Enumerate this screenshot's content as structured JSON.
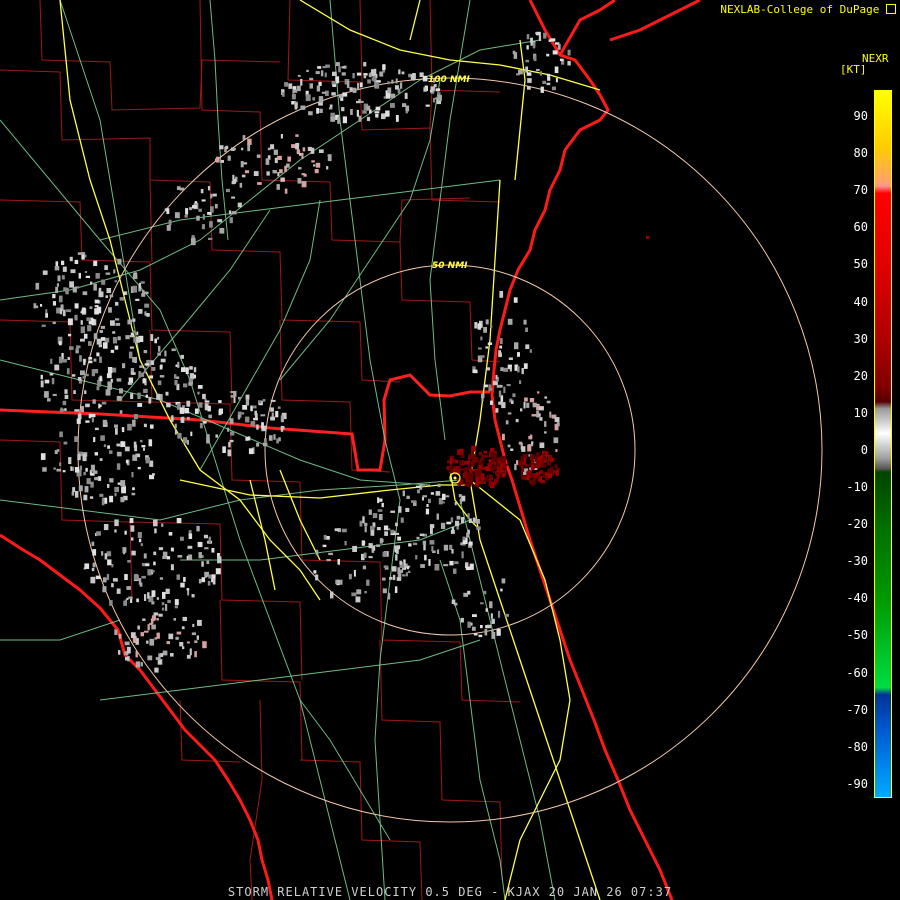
{
  "credit": "NEXLAB-College of DuPage",
  "credit_icon": "link-arrow-icon",
  "legend": {
    "title": "NEXR",
    "unit": "[KT]",
    "ticks": [
      "90",
      "80",
      "70",
      "60",
      "50",
      "40",
      "30",
      "20",
      "10",
      "0",
      "-10",
      "-20",
      "-30",
      "-40",
      "-50",
      "-60",
      "-70",
      "-80",
      "-90"
    ]
  },
  "range_rings": [
    "50 NMI",
    "100 NMI"
  ],
  "footer": "STORM RELATIVE VELOCITY 0.5 DEG - KJAX 20 JAN 26 07:37",
  "colors": {
    "background": "#000000",
    "coastline": "#ff1a1a",
    "county_lines": "#a01818",
    "highways": "#ffff44",
    "roads": "#7fdc9a",
    "range_rings": "#f5c8a8",
    "text": "#ffff00"
  }
}
